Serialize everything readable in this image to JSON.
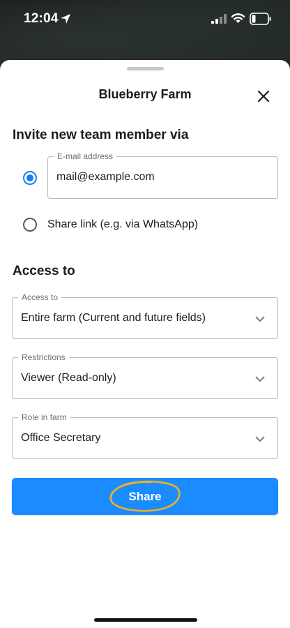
{
  "status_bar": {
    "time": "12:04"
  },
  "sheet": {
    "title": "Blueberry Farm"
  },
  "invite": {
    "heading": "Invite new team member via",
    "email_option": {
      "selected": true,
      "field_label": "E-mail address",
      "value": "mail@example.com"
    },
    "link_option": {
      "selected": false,
      "label": "Share link (e.g. via WhatsApp)"
    }
  },
  "access": {
    "heading": "Access to",
    "fields": [
      {
        "label": "Access to",
        "value": "Entire farm (Current and future fields)"
      },
      {
        "label": "Restrictions",
        "value": "Viewer (Read-only)"
      },
      {
        "label": "Role in farm",
        "value": "Office Secretary"
      }
    ]
  },
  "share_button": {
    "label": "Share"
  },
  "colors": {
    "accent": "#1a8cff",
    "radio": "#1a7fe8",
    "annotation": "#f2b01e"
  },
  "icons": [
    "location-arrow-icon",
    "cellular-signal-icon",
    "wifi-icon",
    "battery-icon",
    "close-icon",
    "chevron-down-icon"
  ]
}
